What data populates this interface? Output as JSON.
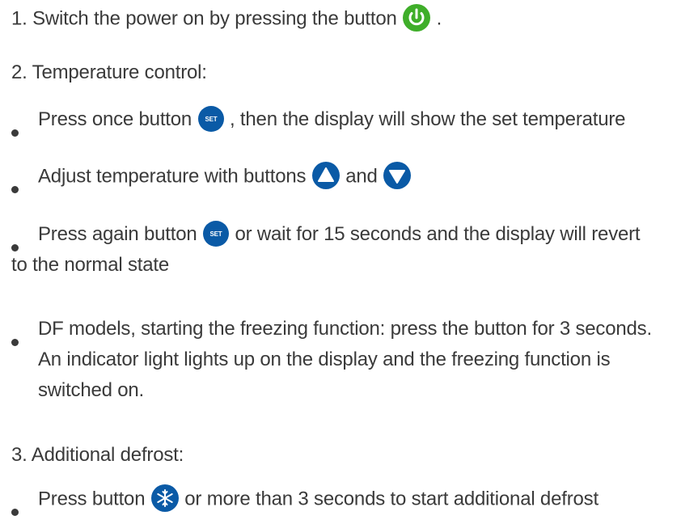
{
  "items": [
    {
      "num": "1.",
      "text_before": "Switch the power on by pressing the button",
      "text_after": "."
    },
    {
      "num": "2.",
      "text": "Temperature control:"
    },
    {
      "text_before": "Press once button",
      "text_after": ",  then the display will show the set temperature"
    },
    {
      "text_before": "Adjust temperature with buttons",
      "text_mid": "and"
    },
    {
      "text_before": "Press again button",
      "text_after": "or wait for 15 seconds and the display will revert",
      "line2": "to the normal state"
    },
    {
      "line1": "DF models, starting the freezing function: press the button for 3 seconds.",
      "line2": "An indicator light lights up on the display and the freezing function is",
      "line3": "switched on."
    },
    {
      "num": "3.",
      "text": "Additional defrost:"
    },
    {
      "text_before": "Press button",
      "text_after": "or more than 3 seconds to start additional defrost"
    }
  ],
  "icons": {
    "set_label": "SET",
    "power_color": "#3fae2a",
    "button_color": "#0a5aa6"
  }
}
